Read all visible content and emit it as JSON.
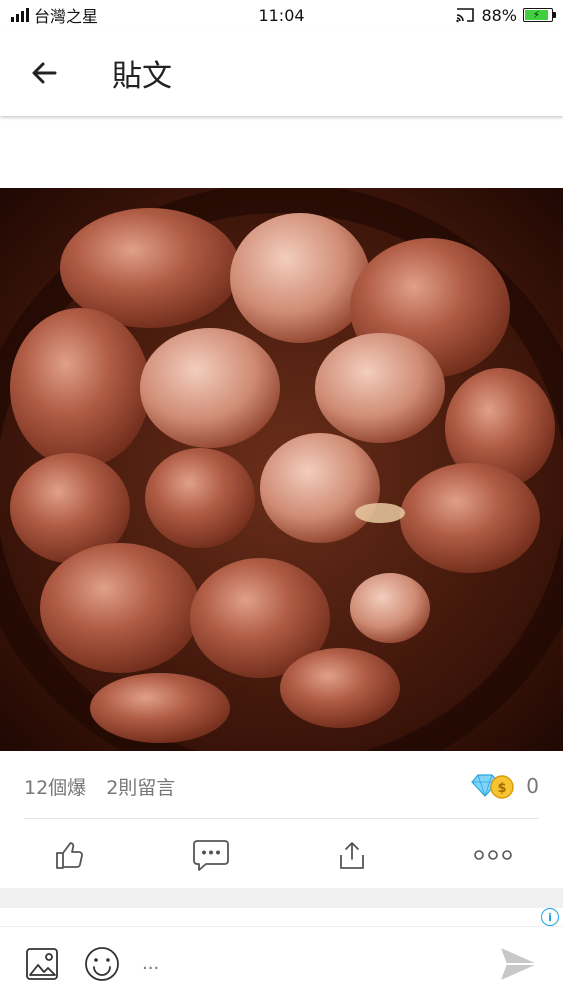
{
  "status_bar": {
    "carrier": "台灣之星",
    "time": "11:04",
    "battery": "88%"
  },
  "app_bar": {
    "title": "貼文"
  },
  "post": {
    "image_icon": "braised-pork-photo"
  },
  "stats": {
    "likes": "12個爆",
    "comments": "2則留言",
    "diamonds": "0"
  },
  "actions": {
    "like_icon": "thumbs-up-icon",
    "comment_icon": "chat-bubble-icon",
    "share_icon": "share-icon",
    "more_icon": "more-icon"
  },
  "comment_bar": {
    "placeholder": "..."
  },
  "colors": {
    "accent": "#1aa3e8",
    "icon_gray": "#555555",
    "battery_green": "#3fcf3f"
  }
}
